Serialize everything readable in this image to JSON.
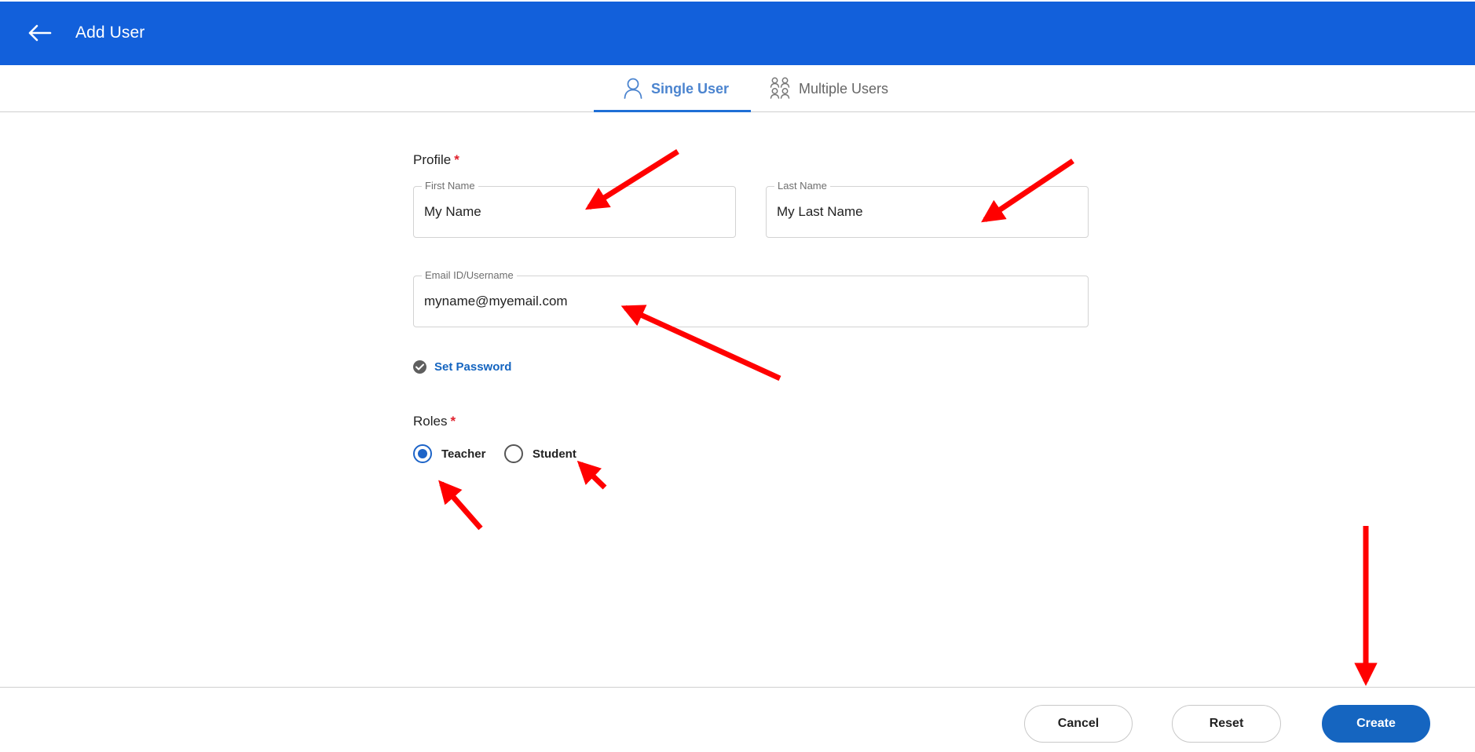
{
  "header": {
    "title": "Add User",
    "background_color": "#1260db",
    "back_icon": "arrow-left-icon"
  },
  "tabs": [
    {
      "label": "Single User",
      "icon": "user-icon",
      "active": true
    },
    {
      "label": "Multiple Users",
      "icon": "users-icon",
      "active": false
    }
  ],
  "profile": {
    "title": "Profile",
    "required_mark": "*",
    "first_name": {
      "label": "First Name",
      "value": "My Name"
    },
    "last_name": {
      "label": "Last Name",
      "value": "My Last Name"
    },
    "email": {
      "label": "Email ID/Username",
      "value": "myname@myemail.com"
    }
  },
  "set_password": {
    "label": "Set Password",
    "icon": "check-circle-icon"
  },
  "roles": {
    "title": "Roles",
    "required_mark": "*",
    "options": [
      {
        "label": "Teacher",
        "selected": true
      },
      {
        "label": "Student",
        "selected": false
      }
    ]
  },
  "footer": {
    "cancel_label": "Cancel",
    "reset_label": "Reset",
    "create_label": "Create"
  },
  "colors": {
    "accent": "#1565c0",
    "required": "#e0202c",
    "annotation_arrow": "#ff0000"
  }
}
